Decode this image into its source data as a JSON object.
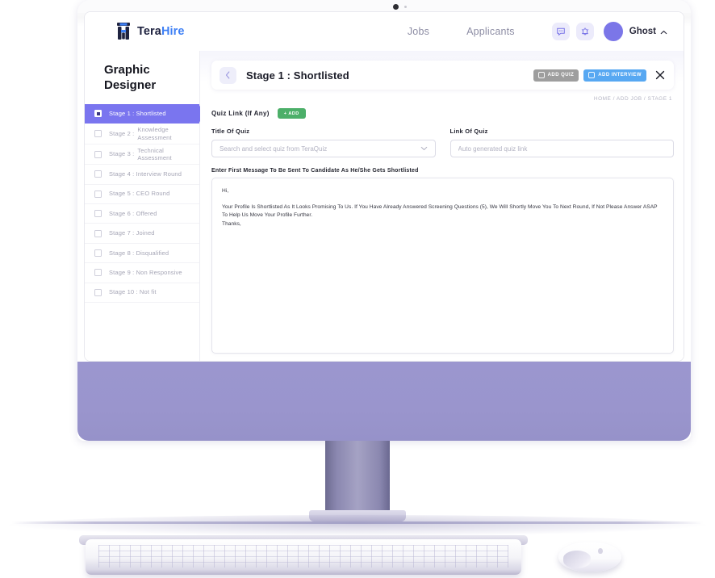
{
  "header": {
    "logo_tera": "Tera",
    "logo_hire": "Hire",
    "nav": [
      {
        "label": "Jobs"
      },
      {
        "label": "Applicants"
      }
    ],
    "icons": [
      {
        "name": "message-icon"
      },
      {
        "name": "notification-bell-icon"
      }
    ],
    "user_name": "Ghost"
  },
  "sidebar": {
    "job_title_line1": "Graphic",
    "job_title_line2": "Designer",
    "items": [
      {
        "prefix": "Stage 1 : Shortlisted",
        "second": "",
        "active": true
      },
      {
        "prefix": "Stage 2 :",
        "second": "Knowledge Assessment",
        "active": false
      },
      {
        "prefix": "Stage 3 :",
        "second": "Technical Assessment",
        "active": false
      },
      {
        "prefix": "Stage 4 : Interview Round",
        "second": "",
        "active": false
      },
      {
        "prefix": "Stage 5 : CEO Round",
        "second": "",
        "active": false
      },
      {
        "prefix": "Stage 6 : Offered",
        "second": "",
        "active": false
      },
      {
        "prefix": "Stage 7 : Joined",
        "second": "",
        "active": false
      },
      {
        "prefix": "Stage 8 : Disqualified",
        "second": "",
        "active": false
      },
      {
        "prefix": "Stage 9 : Non Responsive",
        "second": "",
        "active": false
      },
      {
        "prefix": "Stage 10 : Not fit",
        "second": "",
        "active": false
      }
    ]
  },
  "panel": {
    "title": "Stage 1 : Shortlisted",
    "add_quiz_label": "ADD QUIZ",
    "add_interview_label": "ADD INTERVIEW",
    "breadcrumb": "HOME / ADD JOB / STAGE 1"
  },
  "form": {
    "quiz_link_label": "Quiz Link (If Any)",
    "add_button_label": "+ ADD",
    "title_of_quiz_label": "Title Of Quiz",
    "title_of_quiz_placeholder": "Search and select quiz from TeraQuiz",
    "title_of_quiz_value": "",
    "link_of_quiz_label": "Link Of Quiz",
    "link_of_quiz_placeholder": "Auto generated quiz link",
    "link_of_quiz_value": "",
    "message_label": "Enter First Message To Be Sent To Candidate As He/She Gets Shortlisted",
    "message_line1": "Hi,",
    "message_line2": "Your Profile Is Shortlisted As It Looks Promising To Us. If You Have Already Answered Screening Questions (5), We Will Shortly Move You To Next Round, If Not Please Answer ASAP To Help Us Move Your Profile Further.",
    "message_line3": "Thanks,"
  },
  "colors": {
    "accent_purple": "#7a75ef",
    "brand_blue": "#3d7ff5",
    "add_green": "#4caf69",
    "interview_blue": "#57a8f2",
    "quiz_gray": "#9e9e9e",
    "monitor_chin": "#9b96cf"
  }
}
